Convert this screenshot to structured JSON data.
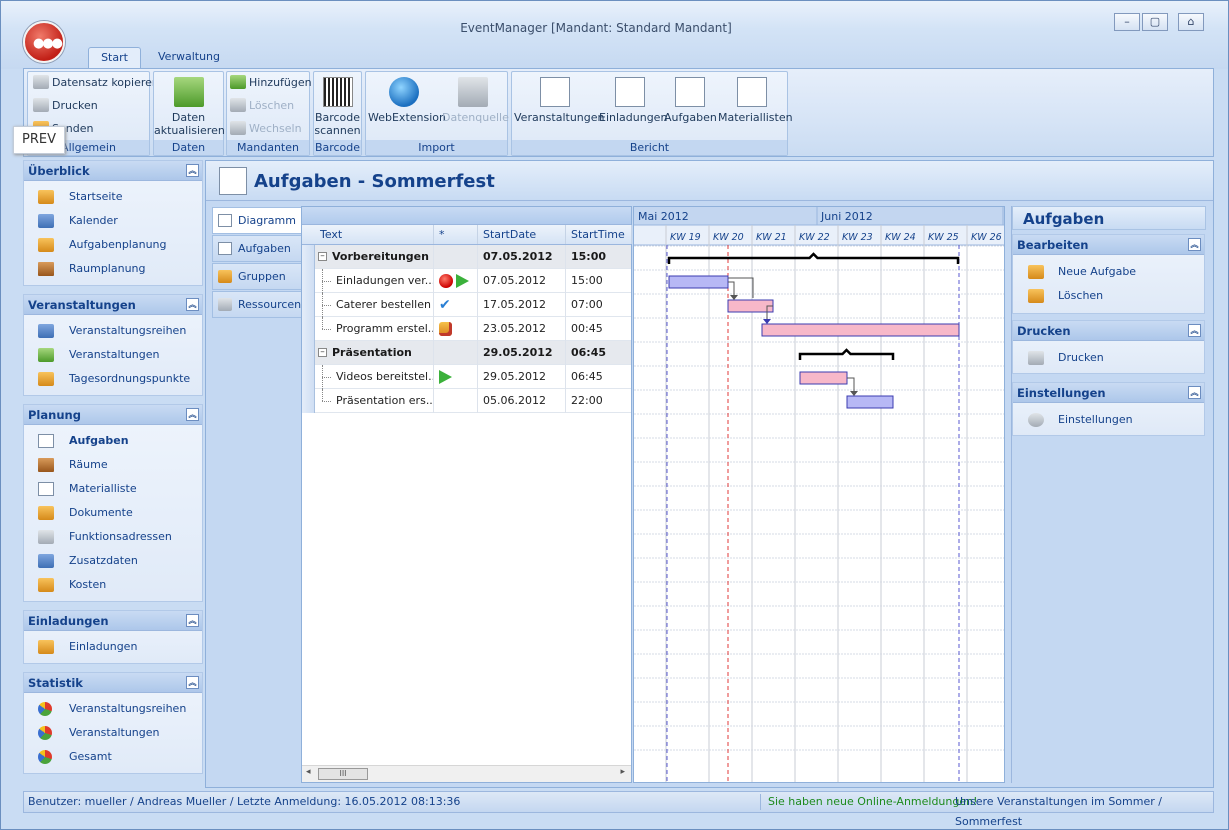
{
  "window": {
    "title": "EventManager [Mandant: Standard Mandant]",
    "controls": {
      "minimize": "–",
      "maximize": "▢",
      "help": "⌂"
    }
  },
  "ribbon": {
    "tabs": [
      "Start",
      "Verwaltung"
    ],
    "groups": {
      "allgemein": {
        "label": "Allgemein",
        "items": [
          "Datensatz kopieren",
          "Drucken",
          "Senden"
        ]
      },
      "daten": {
        "label": "Daten",
        "button": "Daten aktualisieren"
      },
      "mandanten": {
        "label": "Mandanten",
        "items": [
          "Hinzufügen",
          "Löschen",
          "Wechseln"
        ]
      },
      "barcode": {
        "label": "Barcode",
        "button": "Barcode scannen"
      },
      "import": {
        "label": "Import",
        "buttons": [
          "WebExtension",
          "Datenquelle"
        ]
      },
      "bericht": {
        "label": "Bericht",
        "buttons": [
          "Veranstaltungen",
          "Einladungen",
          "Aufgaben",
          "Materiallisten"
        ]
      }
    },
    "tooltip": "PREV"
  },
  "nav": {
    "ueberblick": {
      "title": "Überblick",
      "items": [
        "Startseite",
        "Kalender",
        "Aufgabenplanung",
        "Raumplanung"
      ]
    },
    "veranstaltungen": {
      "title": "Veranstaltungen",
      "items": [
        "Veranstaltungsreihen",
        "Veranstaltungen",
        "Tagesordnungspunkte"
      ]
    },
    "planung": {
      "title": "Planung",
      "items": [
        "Aufgaben",
        "Räume",
        "Materialliste",
        "Dokumente",
        "Funktionsadressen",
        "Zusatzdaten",
        "Kosten"
      ]
    },
    "einladungen": {
      "title": "Einladungen",
      "items": [
        "Einladungen"
      ]
    },
    "statistik": {
      "title": "Statistik",
      "items": [
        "Veranstaltungsreihen",
        "Veranstaltungen",
        "Gesamt"
      ]
    },
    "collapse_glyph": "︽"
  },
  "content": {
    "title": "Aufgaben - Sommerfest",
    "vtabs": [
      "Diagramm",
      "Aufgaben",
      "Gruppen",
      "Ressourcen"
    ],
    "grid": {
      "columns": [
        "Text",
        "*",
        "StartDate",
        "StartTime"
      ],
      "rows": [
        {
          "type": "group",
          "text": "Vorbereitungen",
          "date": "07.05.2012",
          "time": "15:00"
        },
        {
          "type": "task",
          "text": "Einladungen ver...",
          "date": "07.05.2012",
          "time": "15:00",
          "status": [
            "record-icon",
            "play-icon"
          ]
        },
        {
          "type": "task",
          "text": "Caterer bestellen",
          "date": "17.05.2012",
          "time": "07:00",
          "status": [
            "checkmark-icon"
          ]
        },
        {
          "type": "task",
          "text": "Programm erstel...",
          "date": "23.05.2012",
          "time": "00:45",
          "status": [
            "hand-icon"
          ]
        },
        {
          "type": "group",
          "text": "Präsentation",
          "date": "29.05.2012",
          "time": "06:45"
        },
        {
          "type": "task",
          "text": "Videos bereitstel...",
          "date": "29.05.2012",
          "time": "06:45",
          "status": [
            "play-icon"
          ]
        },
        {
          "type": "task",
          "text": "Präsentation ers...",
          "date": "05.06.2012",
          "time": "22:00",
          "status": []
        }
      ],
      "scroll_thumb": "III"
    },
    "gantt": {
      "months": [
        "Mai 2012",
        "Juni 2012"
      ],
      "weeks": [
        "KW 19",
        "KW 20",
        "KW 21",
        "KW 22",
        "KW 23",
        "KW 24",
        "KW 25",
        "KW 26"
      ],
      "colors": {
        "group_bar": "#000000",
        "task_bar_blue": "#b7b8f5",
        "task_bar_pink": "#f7b8c9",
        "today_line": "#e03a3a",
        "dashed_line": "#5a5ad0"
      }
    }
  },
  "side_panel": {
    "title": "Aufgaben",
    "groups": [
      {
        "title": "Bearbeiten",
        "items": [
          "Neue Aufgabe",
          "Löschen"
        ]
      },
      {
        "title": "Drucken",
        "items": [
          "Drucken"
        ]
      },
      {
        "title": "Einstellungen",
        "items": [
          "Einstellungen"
        ]
      }
    ]
  },
  "status": {
    "user": "Benutzer: mueller / Andreas Mueller / Letzte Anmeldung: 16.05.2012 08:13:36",
    "notice": "Sie haben neue Online-Anmeldungen!",
    "context": "Unsere Veranstaltungen im Sommer / Sommerfest"
  }
}
